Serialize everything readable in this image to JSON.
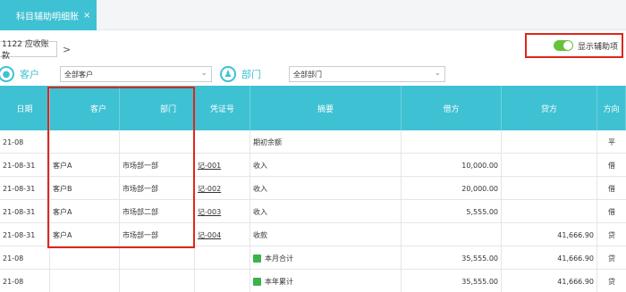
{
  "tab": {
    "label": "科目辅助明细账",
    "close": "×"
  },
  "breadcrumb": {
    "account": "1122 应收账款",
    "arrow": ">"
  },
  "toggle": {
    "label": "显示辅助项",
    "on": true,
    "color": "#67c23a"
  },
  "filters": [
    {
      "label": "客户",
      "value": "全部客户"
    },
    {
      "label": "部门",
      "value": "全部部门"
    }
  ],
  "columns": [
    "日期",
    "客户",
    "部门",
    "凭证号",
    "摘要",
    "借方",
    "贷方",
    "方向"
  ],
  "rows": [
    {
      "date": "21-08",
      "customer": "",
      "dept": "",
      "voucher": "",
      "summary": "期初余额",
      "debit": "",
      "credit": "",
      "dir": "平"
    },
    {
      "date": "21-08-31",
      "customer": "客户A",
      "dept": "市场部一部",
      "voucher": "记-001",
      "summary": "收入",
      "debit": "10,000.00",
      "credit": "",
      "dir": "借"
    },
    {
      "date": "21-08-31",
      "customer": "客户B",
      "dept": "市场部一部",
      "voucher": "记-002",
      "summary": "收入",
      "debit": "20,000.00",
      "credit": "",
      "dir": "借"
    },
    {
      "date": "21-08-31",
      "customer": "客户A",
      "dept": "市场部二部",
      "voucher": "记-003",
      "summary": "收入",
      "debit": "5,555.00",
      "credit": "",
      "dir": "借"
    },
    {
      "date": "21-08-31",
      "customer": "客户A",
      "dept": "市场部一部",
      "voucher": "记-004",
      "summary": "收款",
      "debit": "",
      "credit": "41,666.90",
      "dir": "贷"
    },
    {
      "date": "21-08",
      "customer": "",
      "dept": "",
      "voucher": "",
      "summary": "本月合计",
      "debit": "35,555.00",
      "credit": "41,666.90",
      "dir": "贷"
    },
    {
      "date": "21-08",
      "customer": "",
      "dept": "",
      "voucher": "",
      "summary": "本年累计",
      "debit": "35,555.00",
      "credit": "41,666.90",
      "dir": "贷"
    }
  ],
  "colors": {
    "accent": "#3ec1d3",
    "highlight": "#e0251c"
  }
}
